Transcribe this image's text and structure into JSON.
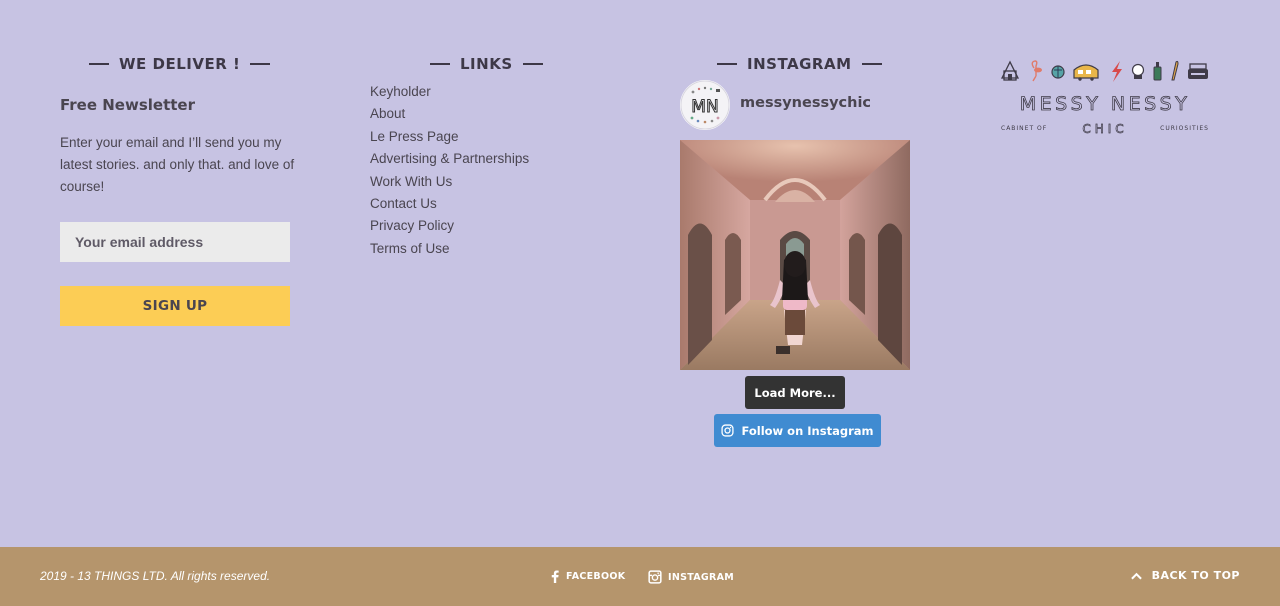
{
  "deliver": {
    "title": "WE DELIVER !",
    "newsletter_title": "Free Newsletter",
    "newsletter_text": "Enter your email and I’ll send you my latest stories. and only that. and love of course!",
    "email_placeholder": "Your email address",
    "signup_label": "SIGN UP"
  },
  "links": {
    "title": "LINKS",
    "items": [
      "Keyholder",
      "About",
      "Le Press Page",
      "Advertising & Partnerships",
      "Work With Us",
      "Contact Us",
      "Privacy Policy",
      "Terms of Use"
    ]
  },
  "instagram": {
    "title": "INSTAGRAM",
    "handle": "messynessychic",
    "avatar_text": "MN",
    "load_more_label": "Load More...",
    "follow_label": "Follow on Instagram"
  },
  "logo": {
    "line1": "MESSY NESSY",
    "left_small": "CABINET OF",
    "center": "CHIC",
    "right_small": "CURIOSITIES"
  },
  "footer": {
    "copyright": "2019 - 13 THINGS LTD. All rights reserved.",
    "facebook_label": "FACEBOOK",
    "instagram_label": "INSTAGRAM",
    "back_to_top_label": "BACK TO TOP"
  },
  "colors": {
    "background": "#c7c3e3",
    "signup_button": "#fccd55",
    "follow_button": "#408bd1",
    "load_more_button": "#333333",
    "footer": "#b5956c"
  }
}
